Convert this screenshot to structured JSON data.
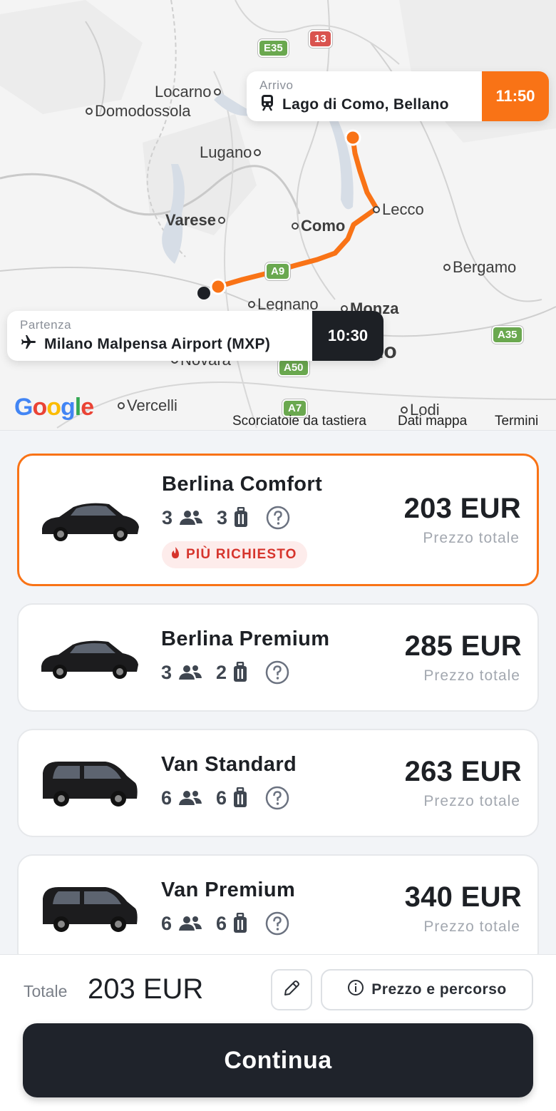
{
  "map": {
    "places": {
      "locarno": "Locarno",
      "domodossola": "Domodossola",
      "lugano": "Lugano",
      "varese": "Varese",
      "como": "Como",
      "lecco": "Lecco",
      "bergamo": "Bergamo",
      "legnano": "Legnano",
      "monza": "Monza",
      "novara": "Novara",
      "vercelli": "Vercelli",
      "lodi": "Lodi",
      "milano_partial": "no"
    },
    "roads": {
      "e35": "E35",
      "r13": "13",
      "a9": "A9",
      "a35": "A35",
      "a50": "A50",
      "a7": "A7"
    },
    "arrival": {
      "label": "Arrivo",
      "name": "Lago di Como, Bellano",
      "time": "11:50"
    },
    "departure": {
      "label": "Partenza",
      "name": "Milano Malpensa Airport (MXP)",
      "time": "10:30"
    },
    "google": "Google",
    "links": {
      "shortcuts": "Scorciatoie da tastiera",
      "map_data": "Dati mappa",
      "terms": "Termini"
    }
  },
  "vehicles": [
    {
      "name": "Berlina Comfort",
      "passengers": "3",
      "luggage": "3",
      "price": "203 EUR",
      "price_label": "Prezzo totale",
      "badge": "PIÙ RICHIESTO",
      "selected": true
    },
    {
      "name": "Berlina Premium",
      "passengers": "3",
      "luggage": "2",
      "price": "285 EUR",
      "price_label": "Prezzo totale"
    },
    {
      "name": "Van Standard",
      "passengers": "6",
      "luggage": "6",
      "price": "263 EUR",
      "price_label": "Prezzo totale"
    },
    {
      "name": "Van Premium",
      "passengers": "6",
      "luggage": "6",
      "price": "340 EUR",
      "price_label": "Prezzo totale"
    }
  ],
  "footer": {
    "total_label": "Totale",
    "total_value": "203 EUR",
    "route_button": "Prezzo e percorso",
    "continue_button": "Continua"
  },
  "colors": {
    "accent": "#f97316",
    "dark": "#1d2025",
    "badge_text": "#d6342c"
  }
}
